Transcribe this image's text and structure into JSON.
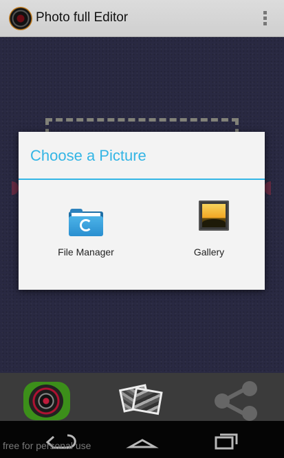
{
  "app": {
    "title": "Photo full Editor",
    "icon": "camera-lens-icon",
    "menu_icon": "overflow-menu-icon"
  },
  "dialog": {
    "title": "Choose a Picture",
    "accent_color": "#33b5e5",
    "options": [
      {
        "label": "File Manager",
        "icon": "folder-sync-icon"
      },
      {
        "label": "Gallery",
        "icon": "gallery-icon"
      }
    ]
  },
  "toolbar": {
    "buttons": [
      {
        "name": "camera",
        "icon": "camera-lens-icon"
      },
      {
        "name": "gallery",
        "icon": "photos-icon"
      },
      {
        "name": "share",
        "icon": "share-icon"
      }
    ]
  },
  "navbar": {
    "buttons": [
      "back-icon",
      "home-icon",
      "recent-apps-icon"
    ]
  },
  "watermark": "free for personal use"
}
